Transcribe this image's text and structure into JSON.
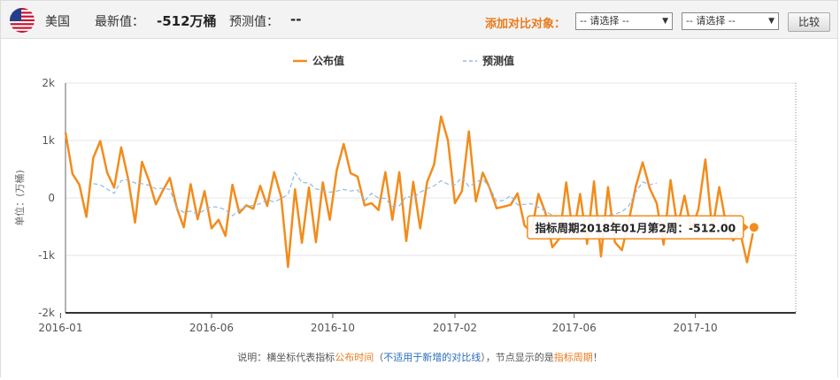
{
  "header": {
    "country": "美国",
    "latest_label": "最新值：",
    "latest_value": "-512万桶",
    "forecast_label": "预测值：",
    "forecast_value": "--",
    "compare_label": "添加对比对象：",
    "select1": "-- 请选择 --",
    "select2": "-- 请选择 --",
    "compare_button": "比较"
  },
  "tooltip": {
    "text": "指标周期2018年01月第2周：-512.00"
  },
  "footnote": {
    "part1": "说明：横坐标代表指标",
    "part2": "公布时间",
    "part3": "（",
    "part4": "不适用于新增的对比线",
    "part5": "），节点显示的是",
    "part6": "指标周期",
    "part7": "！"
  },
  "colors": {
    "actual": "#f28c1c",
    "forecast": "#8fb8e6",
    "accent": "#e87b1c"
  },
  "chart_data": {
    "type": "line",
    "ylabel": "单位：(万桶)",
    "ylim": [
      -2000,
      2000
    ],
    "yticks": [
      -2000,
      -1000,
      0,
      1000,
      2000
    ],
    "ytick_labels": [
      "-2k",
      "-1k",
      "0",
      "1k",
      "2k"
    ],
    "xlim": [
      "2016-01-06",
      "2018-01-10"
    ],
    "xticks": [
      "2016-01-01",
      "2016-06-01",
      "2016-10-01",
      "2017-02-01",
      "2017-06-01",
      "2017-10-01"
    ],
    "xtick_labels": [
      "2016-01",
      "2016-06",
      "2016-10",
      "2017-02",
      "2017-06",
      "2017-10"
    ],
    "legend": {
      "position": "top-center"
    },
    "grid": "horizontal",
    "series": [
      {
        "name": "公布值",
        "style": "solid",
        "start": "2016-01-06",
        "interval_days": 7,
        "values": [
          1140,
          420,
          230,
          -330,
          700,
          990,
          440,
          180,
          880,
          340,
          -430,
          630,
          300,
          -110,
          130,
          350,
          -170,
          -510,
          240,
          -370,
          120,
          -530,
          -380,
          -660,
          230,
          -260,
          -130,
          -190,
          210,
          -140,
          450,
          20,
          -1200,
          150,
          -780,
          180,
          -770,
          270,
          -380,
          480,
          940,
          430,
          370,
          -130,
          -90,
          -210,
          450,
          -380,
          450,
          -750,
          280,
          -530,
          280,
          580,
          1420,
          1000,
          -90,
          120,
          1160,
          -60,
          440,
          170,
          -180,
          -150,
          -120,
          80,
          -480,
          -590,
          70,
          -250,
          -860,
          -710,
          270,
          -660,
          70,
          -800,
          290,
          -1020,
          190,
          -770,
          -910,
          -400,
          200,
          620,
          170,
          -90,
          -810,
          310,
          -520,
          40,
          -560,
          -200,
          670,
          -560,
          190,
          -470,
          -740,
          -590,
          -1120,
          -512
        ]
      },
      {
        "name": "预测值",
        "style": "dashed",
        "start": "2016-01-06",
        "interval_days": 7,
        "values": [
          null,
          null,
          null,
          null,
          250,
          230,
          null,
          80,
          300,
          320,
          260,
          250,
          220,
          160,
          170,
          150,
          -180,
          -250,
          -230,
          -280,
          -210,
          -150,
          -160,
          -210,
          -310,
          -210,
          -150,
          -130,
          -100,
          -30,
          -70,
          -10,
          60,
          440,
          270,
          260,
          160,
          120,
          100,
          120,
          150,
          120,
          140,
          -50,
          80,
          0,
          -10,
          -150,
          -140,
          30,
          0,
          100,
          160,
          210,
          300,
          240,
          230,
          360,
          200,
          270,
          330,
          180,
          -60,
          -40,
          40,
          -120,
          -110,
          -100,
          -160,
          -230,
          -300,
          -360,
          -380,
          -410,
          -380,
          -380,
          -350,
          -330,
          -300,
          -280,
          -240,
          -140,
          100,
          280,
          230,
          260
        ]
      }
    ]
  }
}
